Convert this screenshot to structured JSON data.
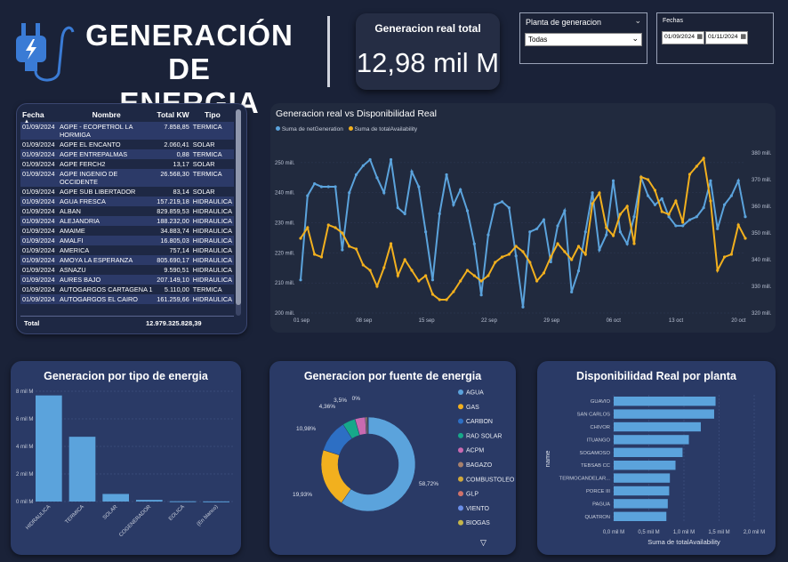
{
  "header": {
    "title_line1": "GENERACIÓN DE",
    "title_line2": "ENERGIA",
    "kpi_label": "Generacion real total",
    "kpi_value": "12,98 mil M"
  },
  "slicers": {
    "plant_label": "Planta de generacion",
    "plant_value": "Todas",
    "dates_label": "Fechas",
    "date_from": "01/09/2024",
    "date_to": "01/11/2024"
  },
  "table": {
    "columns": [
      "Fecha",
      "Nombre",
      "Total KW",
      "Tipo"
    ],
    "rows": [
      [
        "01/09/2024",
        "AGPE - ECOPETROL LA HORMIGA",
        "7.858,85",
        "TERMICA"
      ],
      [
        "01/09/2024",
        "AGPE EL ENCANTO",
        "2.060,41",
        "SOLAR"
      ],
      [
        "01/09/2024",
        "AGPE ENTREPALMAS",
        "0,88",
        "TERMICA"
      ],
      [
        "01/09/2024",
        "AGPE FERCH2",
        "13,17",
        "SOLAR"
      ],
      [
        "01/09/2024",
        "AGPE INGENIO DE OCCIDENTE",
        "26.568,30",
        "TERMICA"
      ],
      [
        "01/09/2024",
        "AGPE SUB LIBERTADOR",
        "83,14",
        "SOLAR"
      ],
      [
        "01/09/2024",
        "AGUA FRESCA",
        "157.219,18",
        "HIDRAULICA"
      ],
      [
        "01/09/2024",
        "ALBAN",
        "829.859,53",
        "HIDRAULICA"
      ],
      [
        "01/09/2024",
        "ALEJANDRIA",
        "188.232,00",
        "HIDRAULICA"
      ],
      [
        "01/09/2024",
        "AMAIME",
        "34.883,74",
        "HIDRAULICA"
      ],
      [
        "01/09/2024",
        "AMALFI",
        "16.805,03",
        "HIDRAULICA"
      ],
      [
        "01/09/2024",
        "AMERICA",
        "757,14",
        "HIDRAULICA"
      ],
      [
        "01/09/2024",
        "AMOYA LA ESPERANZA",
        "805.690,17",
        "HIDRAULICA"
      ],
      [
        "01/09/2024",
        "ASNAZU",
        "9.590,51",
        "HIDRAULICA"
      ],
      [
        "01/09/2024",
        "AURES BAJO",
        "207.149,10",
        "HIDRAULICA"
      ],
      [
        "01/09/2024",
        "AUTOGARGOS CARTAGENA 1",
        "5.110,00",
        "TERMICA"
      ],
      [
        "01/09/2024",
        "AUTOGARGOS EL CAIRO",
        "161.259,66",
        "HIDRAULICA"
      ]
    ],
    "total_label": "Total",
    "total_value": "12.979.325.828,39"
  },
  "line_panel": {
    "title": "Generacion real vs Disponibilidad Real",
    "legend": [
      "Suma de netGeneration",
      "Suma de totalAvailability"
    ]
  },
  "bar_panel": {
    "title": "Generacion por tipo de energia"
  },
  "donut_panel": {
    "title": "Generacion por fuente de energia",
    "legend": [
      "AGUA",
      "GAS",
      "CARBON",
      "RAD SOLAR",
      "ACPM",
      "BAGAZO",
      "COMBUSTOLEO",
      "GLP",
      "VIENTO",
      "BIOGAS"
    ],
    "labels": [
      "58,72%",
      "19,93%",
      "10,98%",
      "4,36%",
      "3,5%",
      "0%"
    ]
  },
  "hbar_panel": {
    "title": "Disponibilidad Real por planta"
  },
  "chart_data": [
    {
      "type": "line",
      "title": "Generacion real vs Disponibilidad Real",
      "x_ticks": [
        "01 sep",
        "08 sep",
        "15 sep",
        "22 sep",
        "29 sep",
        "06 oct",
        "13 oct",
        "20 oct"
      ],
      "y_left_ticks": [
        "200 mill.",
        "210 mill.",
        "220 mill.",
        "230 mill.",
        "240 mill.",
        "250 mill."
      ],
      "y_right_ticks": [
        "320 mill.",
        "330 mill.",
        "340 mill.",
        "350 mill.",
        "360 mill.",
        "370 mill.",
        "380 mill."
      ],
      "y_left_range": [
        200,
        255
      ],
      "y_right_range": [
        320,
        382
      ],
      "colors": [
        "#5ba3dc",
        "#f2b01e"
      ],
      "series": [
        {
          "name": "Suma de netGeneration",
          "axis": "left",
          "values": [
            211,
            239,
            243,
            242,
            242,
            242,
            221,
            240,
            246,
            249,
            251,
            245,
            240,
            251,
            235,
            233,
            247,
            242,
            227,
            211,
            233,
            246,
            236,
            241,
            234,
            223,
            206,
            226,
            236,
            237,
            235,
            219,
            202,
            227,
            228,
            231,
            217,
            229,
            234,
            207,
            214,
            227,
            240,
            221,
            226,
            244,
            227,
            223,
            232,
            245,
            239,
            236,
            238,
            232,
            229,
            229,
            231,
            232,
            235,
            244,
            228,
            236,
            239,
            244,
            232
          ]
        },
        {
          "name": "Suma de totalAvailability",
          "axis": "right",
          "values": [
            348,
            352,
            342,
            341,
            353,
            352,
            350,
            345,
            344,
            338,
            336,
            330,
            337,
            346,
            334,
            340,
            336,
            332,
            334,
            327,
            325,
            325,
            328,
            332,
            336,
            334,
            332,
            334,
            339,
            341,
            342,
            345,
            343,
            339,
            332,
            335,
            341,
            346,
            343,
            340,
            345,
            342,
            361,
            365,
            352,
            349,
            357,
            360,
            346,
            371,
            370,
            366,
            358,
            357,
            362,
            354,
            372,
            375,
            378,
            362,
            336,
            341,
            342,
            353,
            348
          ]
        }
      ]
    },
    {
      "type": "bar",
      "title": "Generacion por tipo de energia",
      "categories": [
        "HIDRAULICA",
        "TERMICA",
        "SOLAR",
        "COGENERADOR",
        "EOLICA",
        "(En blanco)"
      ],
      "values": [
        7.7,
        4.7,
        0.55,
        0.12,
        0.02,
        0.01
      ],
      "y_ticks": [
        "0 mil M",
        "2 mil M",
        "4 mil M",
        "6 mil M",
        "8 mil M"
      ],
      "ylim": [
        0,
        8
      ],
      "color": "#5ba3dc"
    },
    {
      "type": "pie",
      "title": "Generacion por fuente de energia",
      "categories": [
        "AGUA",
        "GAS",
        "CARBON",
        "RAD SOLAR",
        "ACPM",
        "BAGAZO",
        "COMBUSTOLEO",
        "GLP",
        "VIENTO",
        "BIOGAS"
      ],
      "values": [
        58.72,
        19.93,
        10.98,
        4.36,
        3.5,
        0.5,
        0.3,
        0.1,
        0.05,
        0.02
      ],
      "colors": [
        "#5ba3dc",
        "#f2b01e",
        "#2d6fc4",
        "#17a88a",
        "#c96ab0",
        "#a7806c",
        "#d0a83c",
        "#d0726a",
        "#6a8ee8",
        "#c5b64a"
      ]
    },
    {
      "type": "bar",
      "orientation": "horizontal",
      "title": "Disponibilidad Real por planta",
      "categories": [
        "GUAVIO",
        "SAN CARLOS",
        "CHIVOR",
        "ITUANGO",
        "SOGAMOSO",
        "TEBSAB CC",
        "TERMOCANDELAR...",
        "PORCE III",
        "PAGUA",
        "QUATRON"
      ],
      "values": [
        1.45,
        1.43,
        1.24,
        1.07,
        0.98,
        0.88,
        0.8,
        0.79,
        0.77,
        0.75
      ],
      "x_ticks": [
        "0,0 mil M",
        "0,5 mil M",
        "1,0 mil M",
        "1,5 mil M",
        "2,0 mil M"
      ],
      "xlim": [
        0,
        2
      ],
      "xlabel": "Suma de totalAvailability",
      "ylabel": "name",
      "color": "#5ba3dc"
    }
  ]
}
